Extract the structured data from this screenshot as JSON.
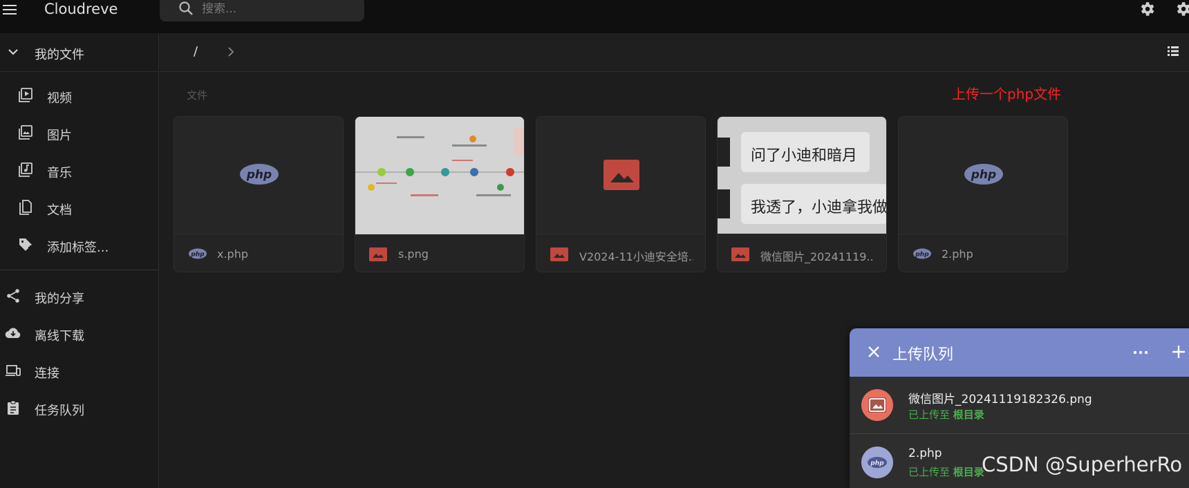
{
  "app": {
    "title": "Cloudreve"
  },
  "search": {
    "placeholder": "搜索..."
  },
  "sidebar": {
    "header": "我的文件",
    "categories": [
      {
        "label": "视频",
        "icon": "video-library-icon"
      },
      {
        "label": "图片",
        "icon": "photo-library-icon"
      },
      {
        "label": "音乐",
        "icon": "music-library-icon"
      },
      {
        "label": "文档",
        "icon": "documents-icon"
      },
      {
        "label": "添加标签...",
        "icon": "add-tag-icon"
      }
    ],
    "nav": [
      {
        "label": "我的分享",
        "icon": "share-icon"
      },
      {
        "label": "离线下载",
        "icon": "cloud-download-icon"
      },
      {
        "label": "连接",
        "icon": "devices-icon"
      },
      {
        "label": "任务队列",
        "icon": "clipboard-icon"
      }
    ]
  },
  "toolbar": {
    "path": "/"
  },
  "files": {
    "section_label": "文件",
    "items": [
      {
        "name": "x.php",
        "type": "php"
      },
      {
        "name": "s.png",
        "type": "image"
      },
      {
        "name": "V2024-11小迪安全培...",
        "type": "image"
      },
      {
        "name": "微信图片_20241119...",
        "type": "image"
      },
      {
        "name": "2.php",
        "type": "php"
      }
    ],
    "chat_preview": [
      "问了小迪和暗月",
      "我透了，小迪拿我做"
    ]
  },
  "annotation": "上传一个php文件",
  "upload_panel": {
    "title": "上传队列",
    "items": [
      {
        "name": "微信图片_20241119182326.png",
        "status_prefix": "已上传至 ",
        "status_target": "根目录",
        "type": "image"
      },
      {
        "name": "2.php",
        "status_prefix": "已上传至 ",
        "status_target": "根目录",
        "type": "php"
      }
    ]
  },
  "watermark": "CSDN @SuperherRo",
  "colors": {
    "panel_header": "#7987cb",
    "success": "#4caf50",
    "image_icon": "#c0483f",
    "annotation": "#ff2020"
  }
}
